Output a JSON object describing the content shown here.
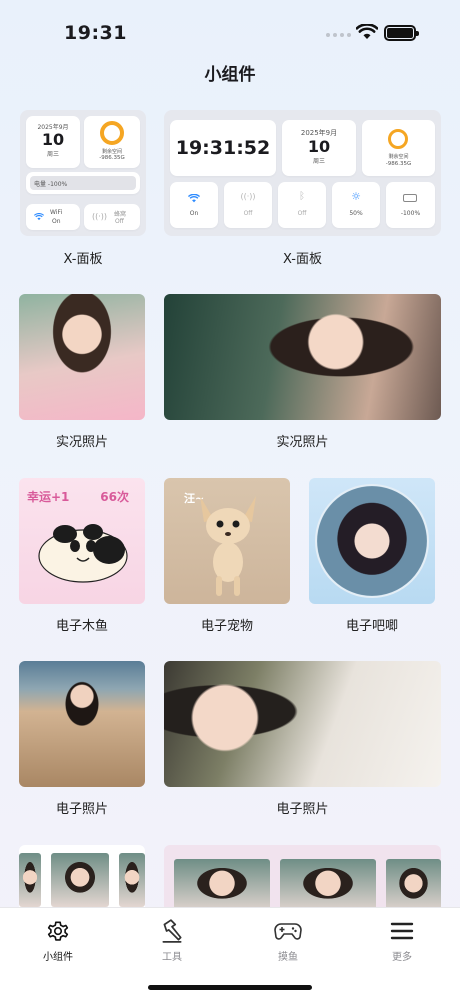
{
  "status_bar": {
    "time": "19:31"
  },
  "page": {
    "title": "小组件"
  },
  "panel_small": {
    "date": "2025年9月",
    "day": "10",
    "weekday": "周三",
    "storage_label": "剩余空间",
    "storage_value": "-986.35G",
    "battery_label": "电量 -100%",
    "wifi_label": "WiFi",
    "wifi_state": "On",
    "cell_label": "蜂窝",
    "cell_state": "Off"
  },
  "panel_large": {
    "clock": "19:31:52",
    "date": "2025年9月",
    "day": "10",
    "weekday": "周三",
    "storage_label": "剩余空间",
    "storage_value": "-986.35G",
    "toggles": [
      {
        "icon": "wifi-icon",
        "state": "On"
      },
      {
        "icon": "cellular-icon",
        "state": "Off"
      },
      {
        "icon": "bluetooth-icon",
        "state": "Off"
      },
      {
        "icon": "brightness-icon",
        "state": "50%"
      },
      {
        "icon": "battery-icon",
        "state": "-100%"
      }
    ]
  },
  "widgets": {
    "panel_small_caption": "X-面板",
    "panel_large_caption": "X-面板",
    "live_small_caption": "实况照片",
    "live_large_caption": "实况照片",
    "muyu_caption": "电子木鱼",
    "pet_caption": "电子宠物",
    "babble_caption": "电子吧唧",
    "photo_small_caption": "电子照片",
    "photo_large_caption": "电子照片"
  },
  "muyu": {
    "luck": "幸运+1",
    "count": "66次"
  },
  "pet": {
    "bark": "汪~"
  },
  "tabs": [
    {
      "label": "小组件",
      "icon": "gear-icon",
      "active": true
    },
    {
      "label": "工具",
      "icon": "hammer-icon",
      "active": false
    },
    {
      "label": "摸鱼",
      "icon": "gamepad-icon",
      "active": false
    },
    {
      "label": "更多",
      "icon": "menu-icon",
      "active": false
    }
  ],
  "colors": {
    "accent": "#f5a623",
    "wifi_blue": "#2f8cff",
    "muyu_text": "#d85a9a"
  }
}
